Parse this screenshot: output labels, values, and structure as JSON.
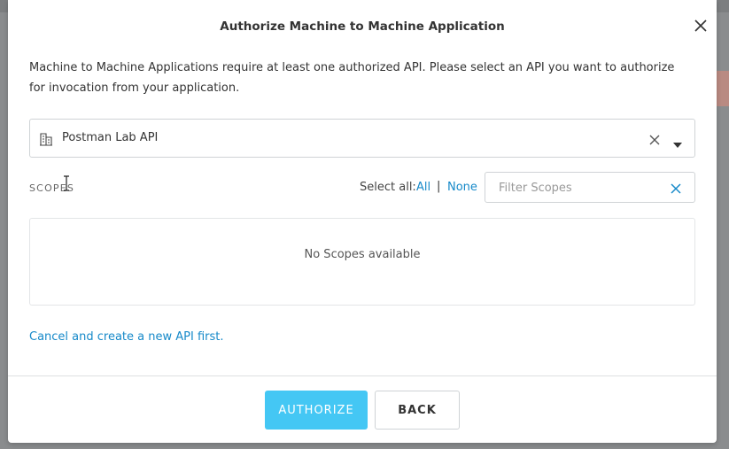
{
  "modal": {
    "title": "Authorize Machine to Machine Application",
    "description": "Machine to Machine Applications require at least one authorized API. Please select an API you want to authorize for invocation from your application."
  },
  "api_select": {
    "selected_value": "Postman Lab API",
    "icon": "building-icon"
  },
  "scopes": {
    "label": "SCOPES",
    "select_all_label": "Select all:",
    "all_label": "All",
    "separator": "|",
    "none_label": "None",
    "filter_placeholder": "Filter Scopes",
    "filter_value": "",
    "empty_message": "No Scopes available"
  },
  "cancel_link": "Cancel and create a new API first.",
  "footer": {
    "authorize_label": "AUTHORIZE",
    "back_label": "BACK"
  },
  "colors": {
    "accent": "#1689c9",
    "primary_button": "#44c7f4",
    "backdrop": "#8a8c8e"
  }
}
